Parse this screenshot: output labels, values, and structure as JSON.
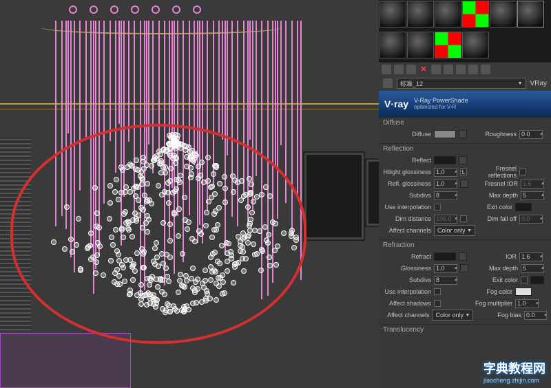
{
  "materialName": "标准_12",
  "rendererShort": "VRay",
  "vray": {
    "brand": "V·ray",
    "title": "V-Ray PowerShade",
    "subtitle": "optimized for V-R"
  },
  "diffuse": {
    "title": "Diffuse",
    "diffuseLabel": "Diffuse",
    "roughnessLabel": "Roughness",
    "roughness": "0.0"
  },
  "reflection": {
    "title": "Reflection",
    "reflectLabel": "Reflect",
    "hilightLabel": "Hilight glossiness",
    "hilight": "1.0",
    "reflGlossLabel": "Refl. glossiness",
    "reflGloss": "1.0",
    "subdivsLabel": "Subdivs",
    "subdivs": "8",
    "useInterpLabel": "Use interpolation",
    "dimDistLabel": "Dim distance",
    "dimDist": "100.0",
    "affectLabel": "Affect channels",
    "affect": "Color only",
    "fresnelLabel": "Fresnel reflections",
    "fresnelIorLabel": "Fresnel IOR",
    "fresnelIor": "1.6",
    "maxDepthLabel": "Max depth",
    "maxDepth": "5",
    "exitColorLabel": "Exit color",
    "dimFalloffLabel": "Dim fall off",
    "dimFalloff": "0.0"
  },
  "refraction": {
    "title": "Refraction",
    "refractLabel": "Refract",
    "glossLabel": "Glossiness",
    "gloss": "1.0",
    "subdivsLabel": "Subdivs",
    "subdivs": "8",
    "useInterpLabel": "Use interpolation",
    "affectShadLabel": "Affect shadows",
    "affectLabel": "Affect channels",
    "affect": "Color only",
    "iorLabel": "IOR",
    "ior": "1.6",
    "maxDepthLabel": "Max depth",
    "maxDepth": "5",
    "exitColorLabel": "Exit color",
    "fogColorLabel": "Fog color",
    "fogMultLabel": "Fog multiplier",
    "fogMult": "1.0",
    "fogBiasLabel": "Fog bias",
    "fogBias": "0.0"
  },
  "transl": {
    "title": "Translucency"
  },
  "watermark": {
    "main": "字典教程网",
    "sub": "jiaocheng.zhijin.com"
  }
}
